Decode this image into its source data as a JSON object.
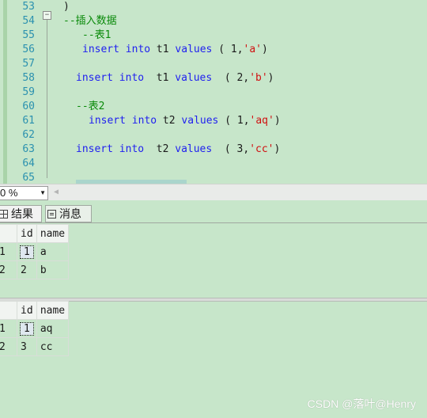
{
  "editor": {
    "line_numbers": [
      "53",
      "54",
      "55",
      "56",
      "57",
      "58",
      "59",
      "60",
      "61",
      "62",
      "63",
      "64",
      "65"
    ],
    "lines": [
      {
        "indent": 0,
        "tokens": [
          {
            "t": ")",
            "c": "nm"
          }
        ]
      },
      {
        "indent": 0,
        "tokens": [
          {
            "t": "--插入数据",
            "c": "cm"
          }
        ]
      },
      {
        "indent": 3,
        "tokens": [
          {
            "t": "--表1",
            "c": "cm"
          }
        ]
      },
      {
        "indent": 3,
        "tokens": [
          {
            "t": "insert",
            "c": "kw"
          },
          {
            "t": " "
          },
          {
            "t": "into",
            "c": "kw"
          },
          {
            "t": " t1 "
          },
          {
            "t": "values",
            "c": "kw"
          },
          {
            "t": " ( 1,"
          },
          {
            "t": "'a'",
            "c": "st"
          },
          {
            "t": ")"
          }
        ]
      },
      {
        "indent": 0,
        "tokens": []
      },
      {
        "indent": 2,
        "tokens": [
          {
            "t": "insert",
            "c": "kw"
          },
          {
            "t": " "
          },
          {
            "t": "into",
            "c": "kw"
          },
          {
            "t": "  t1 "
          },
          {
            "t": "values",
            "c": "kw"
          },
          {
            "t": "  ( 2,"
          },
          {
            "t": "'b'",
            "c": "st"
          },
          {
            "t": ")"
          }
        ]
      },
      {
        "indent": 0,
        "tokens": []
      },
      {
        "indent": 2,
        "tokens": [
          {
            "t": "--表2",
            "c": "cm"
          }
        ]
      },
      {
        "indent": 4,
        "tokens": [
          {
            "t": "insert",
            "c": "kw"
          },
          {
            "t": " "
          },
          {
            "t": "into",
            "c": "kw"
          },
          {
            "t": " t2 "
          },
          {
            "t": "values",
            "c": "kw"
          },
          {
            "t": " ( 1,"
          },
          {
            "t": "'aq'",
            "c": "st"
          },
          {
            "t": ")"
          }
        ]
      },
      {
        "indent": 0,
        "tokens": []
      },
      {
        "indent": 2,
        "tokens": [
          {
            "t": "insert",
            "c": "kw"
          },
          {
            "t": " "
          },
          {
            "t": "into",
            "c": "kw"
          },
          {
            "t": "  t2 "
          },
          {
            "t": "values",
            "c": "kw"
          },
          {
            "t": "  ( 3,"
          },
          {
            "t": "'cc'",
            "c": "st"
          },
          {
            "t": ")"
          }
        ]
      },
      {
        "indent": 0,
        "tokens": []
      },
      {
        "indent": 0,
        "tokens": []
      }
    ]
  },
  "statusbar": {
    "zoom": "0 %",
    "zoom_arrow": "▼",
    "scroll_left": "◀"
  },
  "results": {
    "tabs": {
      "results_label": "结果",
      "messages_label": "消息"
    },
    "table1": {
      "columns": [
        "id",
        "name"
      ],
      "rows": [
        {
          "rn": "1",
          "id": "1",
          "name": "a"
        },
        {
          "rn": "2",
          "id": "2",
          "name": "b"
        }
      ]
    },
    "table2": {
      "columns": [
        "id",
        "name"
      ],
      "rows": [
        {
          "rn": "1",
          "id": "1",
          "name": "aq"
        },
        {
          "rn": "2",
          "id": "3",
          "name": "cc"
        }
      ]
    }
  },
  "watermark": "CSDN @落叶@Henry"
}
